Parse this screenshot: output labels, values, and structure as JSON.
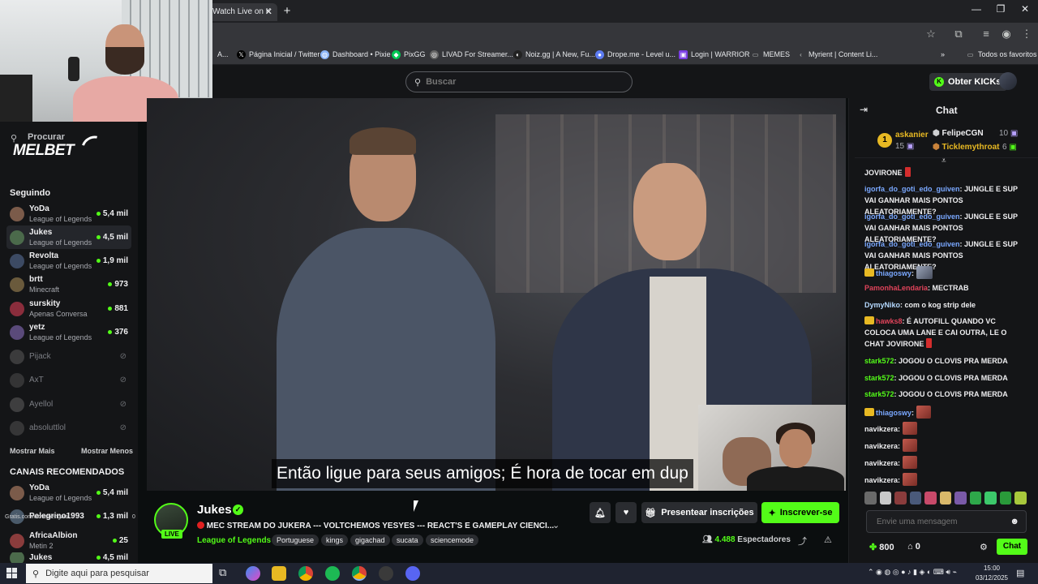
{
  "browser": {
    "tab_title": "Watch Live on K",
    "bookmarks": [
      {
        "label": "A...",
        "icon": "folder-icon"
      },
      {
        "label": "Página Inicial / Twitter",
        "icon": "x-icon"
      },
      {
        "label": "Dashboard • Pixie",
        "icon": "pixie-icon"
      },
      {
        "label": "PixGG",
        "icon": "pixgg-icon"
      },
      {
        "label": "LIVAD For Streamer...",
        "icon": "livad-icon"
      },
      {
        "label": "Noiz.gg | A New, Fu...",
        "icon": "noiz-icon"
      },
      {
        "label": "Drope.me - Level u...",
        "icon": "drope-icon"
      },
      {
        "label": "Login | WARRIOR",
        "icon": "warrior-icon"
      },
      {
        "label": "MEMES",
        "icon": "folder-icon"
      },
      {
        "label": "Myrient | Content Li...",
        "icon": "myrient-icon"
      }
    ],
    "all_bookmarks": "Todos os favoritos"
  },
  "header": {
    "search_placeholder": "Buscar",
    "kicks_label": "Obter KICKs"
  },
  "sidebar": {
    "search_label": "Procurar",
    "sponsor": "MELBET",
    "following_heading": "Seguindo",
    "following": [
      {
        "name": "YoDa",
        "category": "League of Legends",
        "viewers": "5,4 mil",
        "color": "#7b5b4a"
      },
      {
        "name": "Jukes",
        "category": "League of Legends",
        "viewers": "4,5 mil",
        "color": "#4b6a4b"
      },
      {
        "name": "Revolta",
        "category": "League of Legends",
        "viewers": "1,9 mil",
        "color": "#3c4a63"
      },
      {
        "name": "brtt",
        "category": "Minecraft",
        "viewers": "973",
        "color": "#6a5a3c"
      },
      {
        "name": "surskity",
        "category": "Apenas Conversa",
        "viewers": "881",
        "color": "#8a2d3c"
      },
      {
        "name": "yetz",
        "category": "League of Legends",
        "viewers": "376",
        "color": "#5a4a7a"
      }
    ],
    "offline": [
      "Pijack",
      "AxT",
      "Ayellol",
      "absoluttlol"
    ],
    "show_more": "Mostrar Mais",
    "show_less": "Mostrar Menos",
    "recommended_heading": "CANAIS RECOMENDADOS",
    "recommended": [
      {
        "name": "YoDa",
        "category": "League of Legends",
        "viewers": "5,4 mil",
        "color": "#7b5b4a"
      },
      {
        "name": "Pelegrino1993",
        "category": "",
        "viewers": "1,3 mil",
        "color": "#4a5a6a"
      },
      {
        "name": "AfricaAlbion",
        "category": "Metin 2",
        "viewers": "25",
        "color": "#8a3c3c"
      },
      {
        "name": "Jukes",
        "category": "",
        "viewers": "4,5 mil",
        "color": "#4b6a4b"
      }
    ],
    "overlay_text": "Gratis.com/clovisbengala",
    "overlay_num": "0"
  },
  "video": {
    "subtitle": "Então ligue para seus amigos;  É hora de tocar em dup"
  },
  "stream": {
    "streamer": "Jukes",
    "live_badge": "LIVE",
    "title": "MEC STREAM DO JUKERA  --- VOLTCHEMOS YESYES --- REACT'S E GAMEPLAY CIENCI...",
    "category": "League of Legends",
    "tags": [
      "Portuguese",
      "kings",
      "gigachad",
      "sucata",
      "sciencemode"
    ],
    "gift_label": "Presentear inscrições",
    "subscribe_label": "Inscrever-se",
    "viewers": "4.488",
    "viewers_label": "Espectadores"
  },
  "chat": {
    "title": "Chat",
    "leaderboard": {
      "rank1": {
        "name": "askanier",
        "rank": "1",
        "score": "15"
      },
      "rank2": {
        "name": "FelipeCGN",
        "score": "10"
      },
      "rank3": {
        "name": "Ticklemythroat",
        "score": "6"
      }
    },
    "messages": [
      {
        "user": "",
        "text": "JOVIRONE",
        "color": "#efeff1"
      },
      {
        "user": "igorfa_do_goti_edo_guiven",
        "text": ": JUNGLE E SUP VAI GANHAR MAIS PONTOS ALEATORIAMENTE?",
        "color": "#7aa8ff"
      },
      {
        "user": "igorfa_do_goti_edo_guiven",
        "text": ": JUNGLE E SUP VAI GANHAR MAIS PONTOS ALEATORIAMENTE?",
        "color": "#7aa8ff"
      },
      {
        "user": "igorfa_do_goti_edo_guiven",
        "text": ": JUNGLE E SUP VAI GANHAR MAIS PONTOS ALEATORIAMENTE?",
        "color": "#7aa8ff"
      },
      {
        "user": "thiagoswy",
        "text": ":",
        "color": "#7aa8ff"
      },
      {
        "user": "PamonhaLendaria",
        "text": ": MECTRAB",
        "color": "#e0435a"
      },
      {
        "user": "DymyNiko",
        "text": ": com o kog strip dele",
        "color": "#b5d9ff"
      },
      {
        "user": "hawks8",
        "text": ": É AUTOFILL QUANDO VC COLOCA UMA LANE E CAI OUTRA, LE O CHAT JOVIRONE",
        "color": "#e0435a"
      },
      {
        "user": "stark572",
        "text": ": JOGOU O CLOVIS PRA MERDA",
        "color": "#53fc18"
      },
      {
        "user": "stark572",
        "text": ": JOGOU O CLOVIS PRA MERDA",
        "color": "#53fc18"
      },
      {
        "user": "stark572",
        "text": ": JOGOU O CLOVIS PRA MERDA",
        "color": "#53fc18"
      },
      {
        "user": "thiagoswy",
        "text": ":",
        "color": "#7aa8ff"
      },
      {
        "user": "navikzera",
        "text": ":",
        "color": "#efeff1"
      },
      {
        "user": "navikzera",
        "text": ":",
        "color": "#efeff1"
      },
      {
        "user": "navikzera",
        "text": ":",
        "color": "#efeff1"
      },
      {
        "user": "navikzera",
        "text": ":",
        "color": "#efeff1"
      }
    ],
    "input_placeholder": "Envie uma mensagem",
    "points": "800",
    "gifts": "0",
    "send_label": "Chat"
  },
  "taskbar": {
    "search_placeholder": "Digite aqui para pesquisar",
    "time": "15:00",
    "date": "03/12/2025"
  }
}
